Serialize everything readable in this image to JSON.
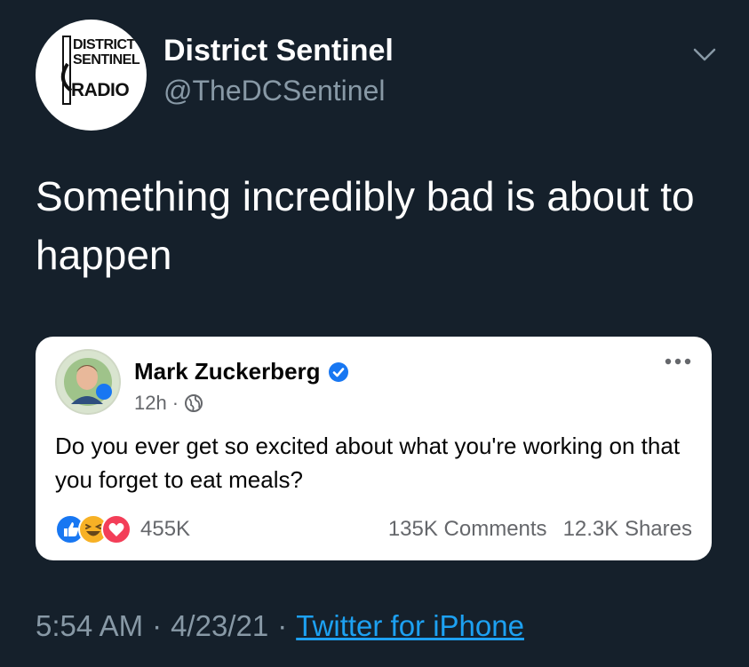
{
  "author": {
    "display_name": "District Sentinel",
    "handle": "@TheDCSentinel",
    "avatar_text": {
      "line1": "DISTRICT",
      "line2": "SENTINEL",
      "line3": "RADIO"
    }
  },
  "tweet": {
    "text": "Something incredibly bad is about to happen"
  },
  "embedded_post": {
    "name": "Mark Zuckerberg",
    "time": "12h",
    "meta_separator": "·",
    "text": "Do you ever get so excited about what you're working on that you forget to eat  meals?",
    "reaction_count": "455K",
    "comments": "135K Comments",
    "shares": "12.3K Shares",
    "reactions": [
      "like-icon",
      "haha-icon",
      "love-icon"
    ],
    "verified": true
  },
  "footer": {
    "time": "5:54 AM",
    "separator1": "·",
    "date": "4/23/21",
    "separator2": "·",
    "source": "Twitter for iPhone"
  },
  "colors": {
    "background": "#15202b",
    "secondary_text": "#8899a6",
    "link": "#1da1f2",
    "fb_blue": "#1877f2"
  }
}
